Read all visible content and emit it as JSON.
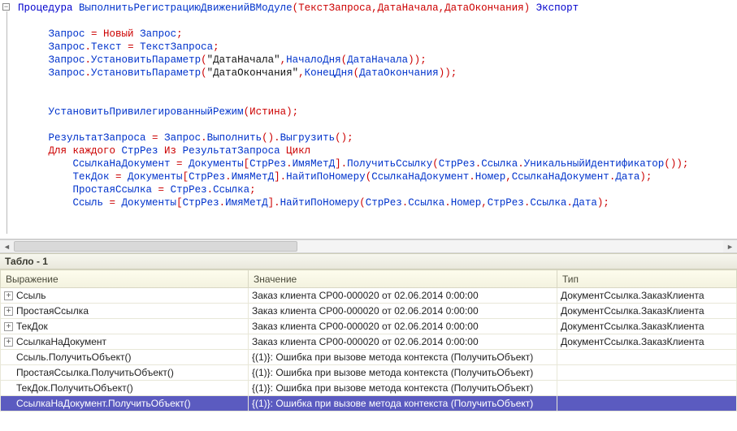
{
  "code": {
    "sig_kw1": "Процедура",
    "sig_name": "ВыполнитьРегистрациюДвиженийВМодуле",
    "sig_params": "(ТекстЗапроса,ДатаНачала,ДатаОкончания)",
    "sig_kw2": "Экспорт",
    "l2a": "Запрос ",
    "l2eq": "=",
    "l2b": " Новый ",
    "l2c": "Запрос",
    "l2sc": ";",
    "l3a": "Запрос",
    "l3d": ".",
    "l3b": "Текст ",
    "l3eq": "=",
    "l3c": " ТекстЗапроса",
    "l3sc": ";",
    "l4a": "Запрос",
    "l4d": ".",
    "l4b": "УстановитьПараметр",
    "l4p1": "(",
    "l4s1": "\"ДатаНачала\"",
    "l4c1": ",",
    "l4f": "НачалоДня",
    "l4p2": "(",
    "l4arg": "ДатаНачала",
    "l4p3": "))",
    "l4sc": ";",
    "l5a": "Запрос",
    "l5d": ".",
    "l5b": "УстановитьПараметр",
    "l5p1": "(",
    "l5s1": "\"ДатаОкончания\"",
    "l5c1": ",",
    "l5f": "КонецДня",
    "l5p2": "(",
    "l5arg": "ДатаОкончания",
    "l5p3": "))",
    "l5sc": ";",
    "l7a": "УстановитьПривилегированныйРежим",
    "l7p1": "(",
    "l7v": "Истина",
    "l7p2": ")",
    "l7sc": ";",
    "l9a": "РезультатЗапроса ",
    "l9eq": "=",
    "l9b": " Запрос",
    "l9d1": ".",
    "l9m1": "Выполнить",
    "l9p1": "()",
    "l9d2": ".",
    "l9m2": "Выгрузить",
    "l9p2": "()",
    "l9sc": ";",
    "l10a": "Для каждого ",
    "l10b": "СтрРез ",
    "l10c": "Из ",
    "l10d": "РезультатЗапроса ",
    "l10e": "Цикл",
    "l11a": "СсылкаНаДокумент ",
    "l11eq": "=",
    "l11b": " Документы",
    "l11br1": "[",
    "l11c": "СтрРез",
    "l11d1": ".",
    "l11d": "ИмяМетД",
    "l11br2": "]",
    "l11d2": ".",
    "l11m": "ПолучитьСсылку",
    "l11p1": "(",
    "l11e": "СтрРез",
    "l11d3": ".",
    "l11f": "Ссылка",
    "l11d4": ".",
    "l11g": "УникальныйИдентификатор",
    "l11p2": "())",
    "l11sc": ";",
    "l12a": "ТекДок ",
    "l12eq": "=",
    "l12b": " Документы",
    "l12br1": "[",
    "l12c": "СтрРез",
    "l12d1": ".",
    "l12d": "ИмяМетД",
    "l12br2": "]",
    "l12d2": ".",
    "l12m": "НайтиПоНомеру",
    "l12p1": "(",
    "l12e": "СсылкаНаДокумент",
    "l12d3": ".",
    "l12f": "Номер",
    "l12c1": ",",
    "l12g": "СсылкаНаДокумент",
    "l12d4": ".",
    "l12h": "Дата",
    "l12p2": ")",
    "l12sc": ";",
    "l13a": "ПростаяСсылка ",
    "l13eq": "=",
    "l13b": " СтрРез",
    "l13d": ".",
    "l13c": "Ссылка",
    "l13sc": ";",
    "l14a": "Ссыль ",
    "l14eq": "=",
    "l14b": " Документы",
    "l14br1": "[",
    "l14c": "СтрРез",
    "l14d1": ".",
    "l14d": "ИмяМетД",
    "l14br2": "]",
    "l14d2": ".",
    "l14m": "НайтиПоНомеру",
    "l14p1": "(",
    "l14e": "СтрРез",
    "l14d3": ".",
    "l14f": "Ссылка",
    "l14d4": ".",
    "l14g": "Номер",
    "l14c1": ",",
    "l14h": "СтрРез",
    "l14d5": ".",
    "l14i": "Ссылка",
    "l14d6": ".",
    "l14j": "Дата",
    "l14p2": ")",
    "l14sc": ";"
  },
  "panel": {
    "title": "Табло - 1"
  },
  "watch": {
    "cols": {
      "expr": "Выражение",
      "val": "Значение",
      "type": "Тип"
    },
    "rows": [
      {
        "exp": true,
        "expr": "Ссыль",
        "val": "Заказ клиента СР00-000020 от 02.06.2014 0:00:00",
        "type": "ДокументСсылка.ЗаказКлиента",
        "sel": false
      },
      {
        "exp": true,
        "expr": "ПростаяСсылка",
        "val": "Заказ клиента СР00-000020 от 02.06.2014 0:00:00",
        "type": "ДокументСсылка.ЗаказКлиента",
        "sel": false
      },
      {
        "exp": true,
        "expr": "ТекДок",
        "val": "Заказ клиента СР00-000020 от 02.06.2014 0:00:00",
        "type": "ДокументСсылка.ЗаказКлиента",
        "sel": false
      },
      {
        "exp": true,
        "expr": "СсылкаНаДокумент",
        "val": "Заказ клиента СР00-000020 от 02.06.2014 0:00:00",
        "type": "ДокументСсылка.ЗаказКлиента",
        "sel": false
      },
      {
        "exp": false,
        "expr": "Ссыль.ПолучитьОбъект()",
        "val": "{(1)}: Ошибка при вызове метода контекста (ПолучитьОбъект)",
        "type": "",
        "sel": false
      },
      {
        "exp": false,
        "expr": "ПростаяСсылка.ПолучитьОбъект()",
        "val": "{(1)}: Ошибка при вызове метода контекста (ПолучитьОбъект)",
        "type": "",
        "sel": false
      },
      {
        "exp": false,
        "expr": "ТекДок.ПолучитьОбъект()",
        "val": "{(1)}: Ошибка при вызове метода контекста (ПолучитьОбъект)",
        "type": "",
        "sel": false
      },
      {
        "exp": false,
        "expr": "СсылкаНаДокумент.ПолучитьОбъект()",
        "val": "{(1)}: Ошибка при вызове метода контекста (ПолучитьОбъект)",
        "type": "",
        "sel": true
      }
    ]
  }
}
